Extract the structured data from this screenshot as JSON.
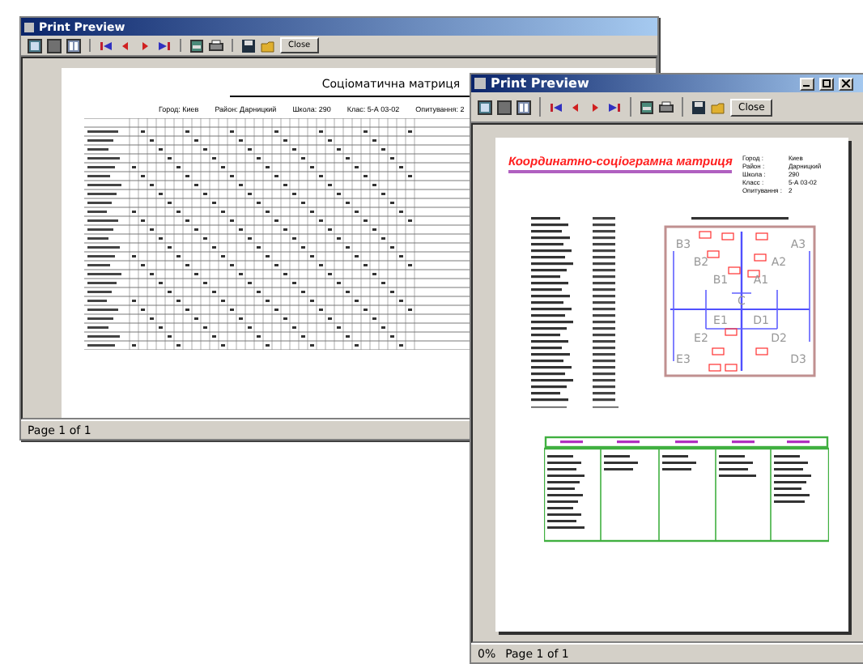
{
  "back_window": {
    "title": "Print Preview",
    "close_label": "Close",
    "page_status": "Page 1 of 1",
    "report": {
      "title": "Соціоматична матриця",
      "fields": [
        "Город: Киев",
        "Район: Дарницкий",
        "Школа: 290",
        "Клас: 5-А 03-02",
        "Опитування: 2"
      ]
    }
  },
  "front_window": {
    "title": "Print Preview",
    "close_label": "Close",
    "zoom": "0%",
    "page_status": "Page 1 of 1",
    "report": {
      "title": "Координатно-соціограмна матриця",
      "fields": [
        {
          "label": "Город :",
          "value": "Киев"
        },
        {
          "label": "Район :",
          "value": "Дарницкий"
        },
        {
          "label": "Школа :",
          "value": "290"
        },
        {
          "label": "Класс :",
          "value": "5-А 03-02"
        },
        {
          "label": "Опитування :",
          "value": "2"
        }
      ],
      "diagram_labels": [
        "B3",
        "A3",
        "B2",
        "A2",
        "B1",
        "A1",
        "C",
        "E1",
        "D1",
        "E2",
        "D2",
        "E3",
        "D3"
      ]
    }
  }
}
